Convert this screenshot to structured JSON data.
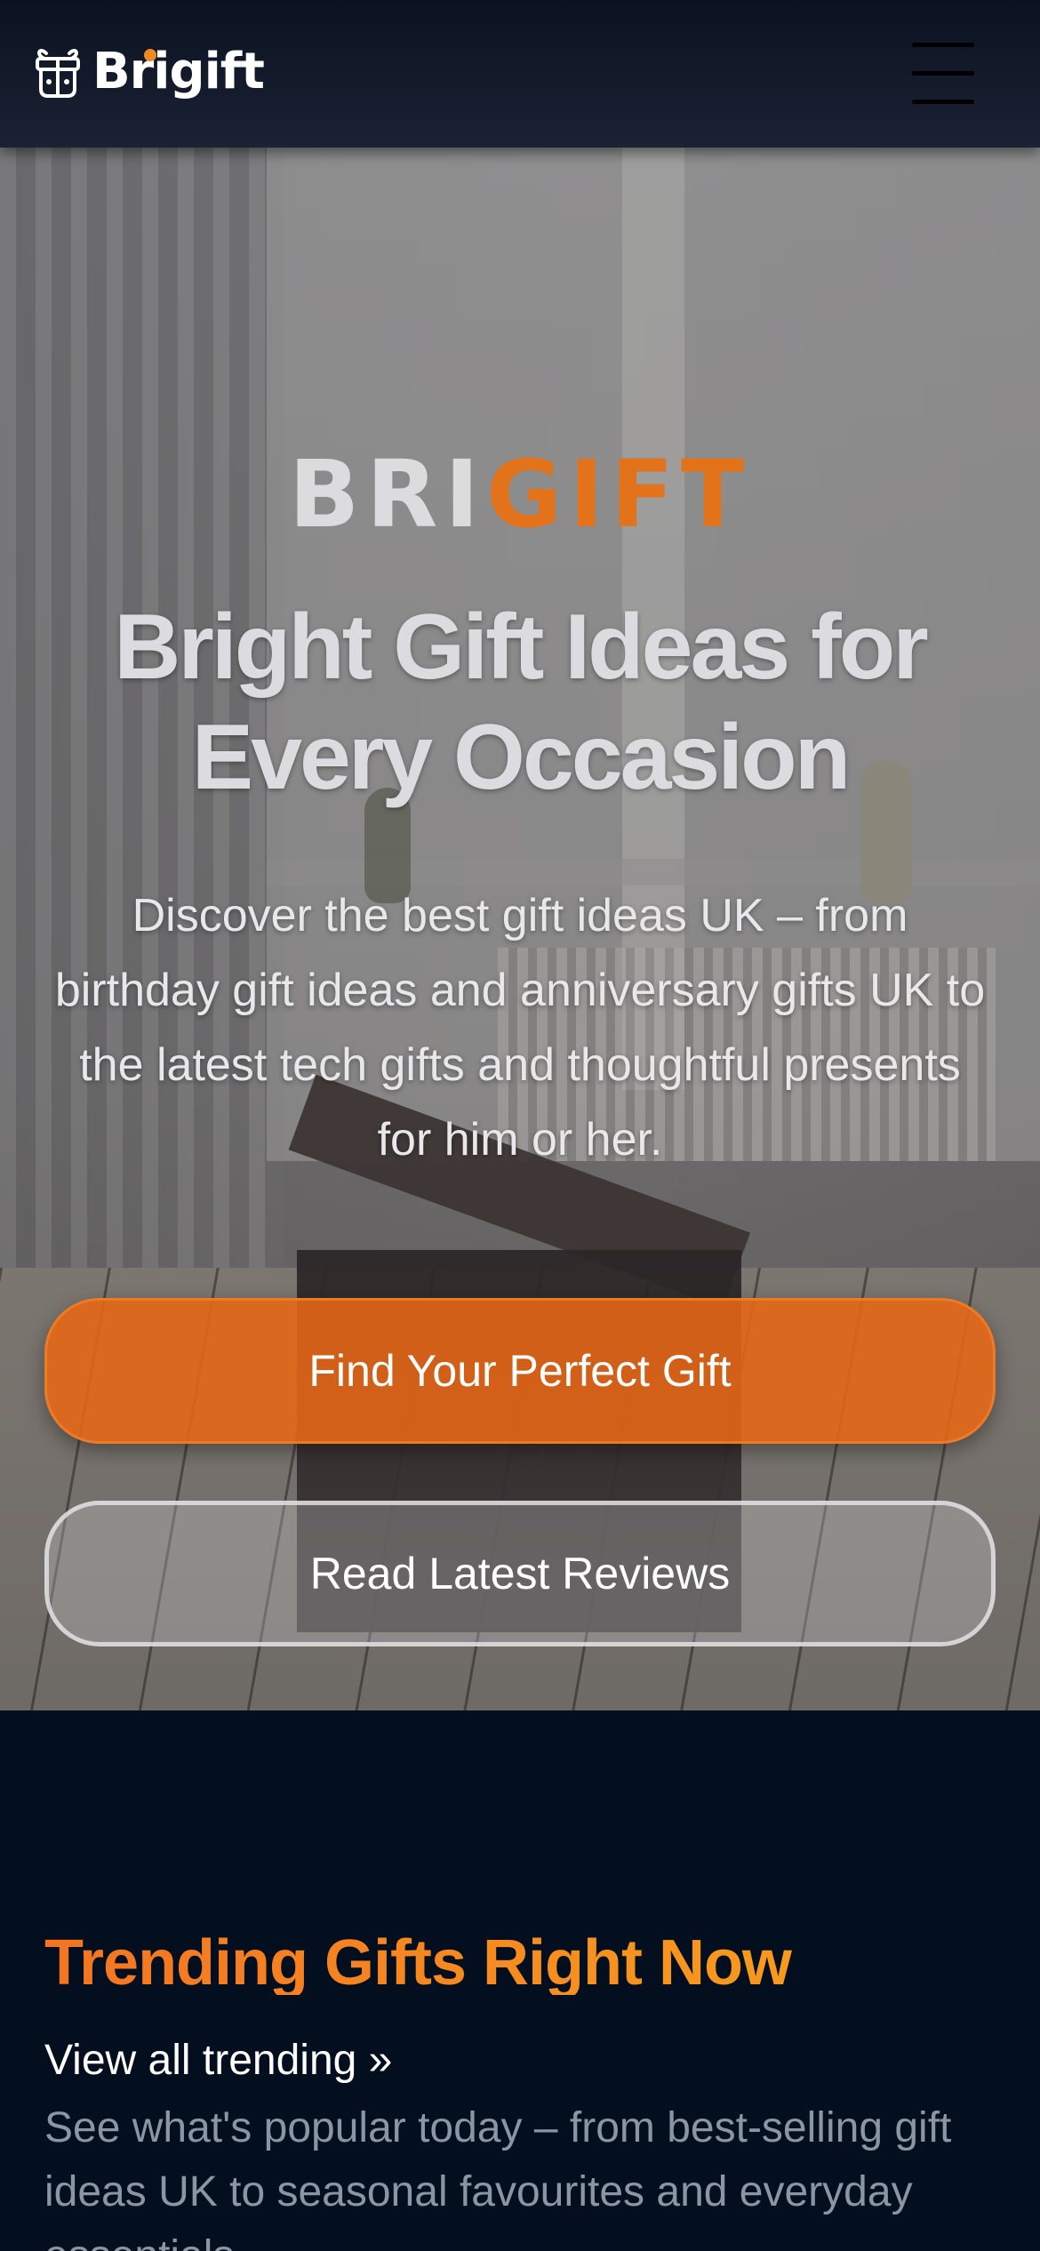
{
  "header": {
    "logo_text": "Brigift",
    "logo_icon": "gift-gamepad-icon",
    "menu_icon": "hamburger-menu-icon"
  },
  "hero": {
    "brand_part1": "BRI",
    "brand_part2": "GIFT",
    "box_brand": "Brigift",
    "title": "Bright Gift Ideas for Every Occasion",
    "description": "Discover the best gift ideas UK – from birthday gift ideas and anniversary gifts UK to the latest tech gifts and thoughtful presents for him or her.",
    "primary_cta": "Find Your Perfect Gift",
    "secondary_cta": "Read Latest Reviews"
  },
  "trending": {
    "title": "Trending Gifts Right Now",
    "view_all": "View all trending »",
    "description": "See what's popular today – from best-selling gift ideas UK to seasonal favourites and everyday essentials"
  },
  "colors": {
    "accent_orange": "#e2731b",
    "accent_gold": "#f7a51d",
    "header_bg": "#0b1222",
    "section_bg": "#030f1f"
  }
}
